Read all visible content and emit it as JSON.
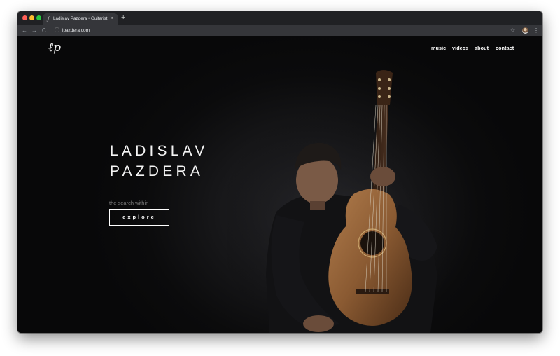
{
  "browser": {
    "tab_title": "Ladislav Pazdera • Guitarist &...",
    "tab_close": "✕",
    "new_tab": "+",
    "url": "lpazdera.com",
    "back_icon": "←",
    "forward_icon": "→",
    "reload_icon": "C",
    "info_icon": "ⓘ",
    "star_icon": "☆",
    "menu_icon": "⋮"
  },
  "site": {
    "logo": "ℓp",
    "nav": [
      "music",
      "videos",
      "about",
      "contact"
    ],
    "hero": {
      "name_line1": "LADISLAV",
      "name_line2": "PAZDERA",
      "tagline": "the search within",
      "cta": "explore"
    }
  },
  "colors": {
    "background": "#0c0c0e",
    "text": "#ffffff",
    "tagline": "#808080",
    "guitar": "#8a5a32"
  }
}
